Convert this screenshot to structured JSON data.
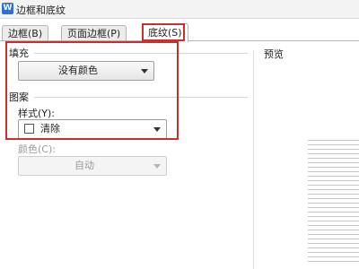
{
  "window": {
    "title": "边框和底纹",
    "icon": "wps-writer-icon",
    "icon_glyph": "W"
  },
  "tabs": [
    {
      "label": "边框(B)",
      "active": false
    },
    {
      "label": "页面边框(P)",
      "active": false
    },
    {
      "label": "底纹(S)",
      "active": true
    }
  ],
  "fill": {
    "section_label": "填充",
    "color_value": "没有颜色"
  },
  "pattern": {
    "section_label": "图案",
    "style_label": "样式(Y):",
    "style_value": "清除",
    "color_label": "颜色(C):",
    "color_value": "自动"
  },
  "preview": {
    "label": "预览"
  },
  "colors": {
    "highlight": "#c9302c",
    "app_icon": "#2f6fd6"
  }
}
